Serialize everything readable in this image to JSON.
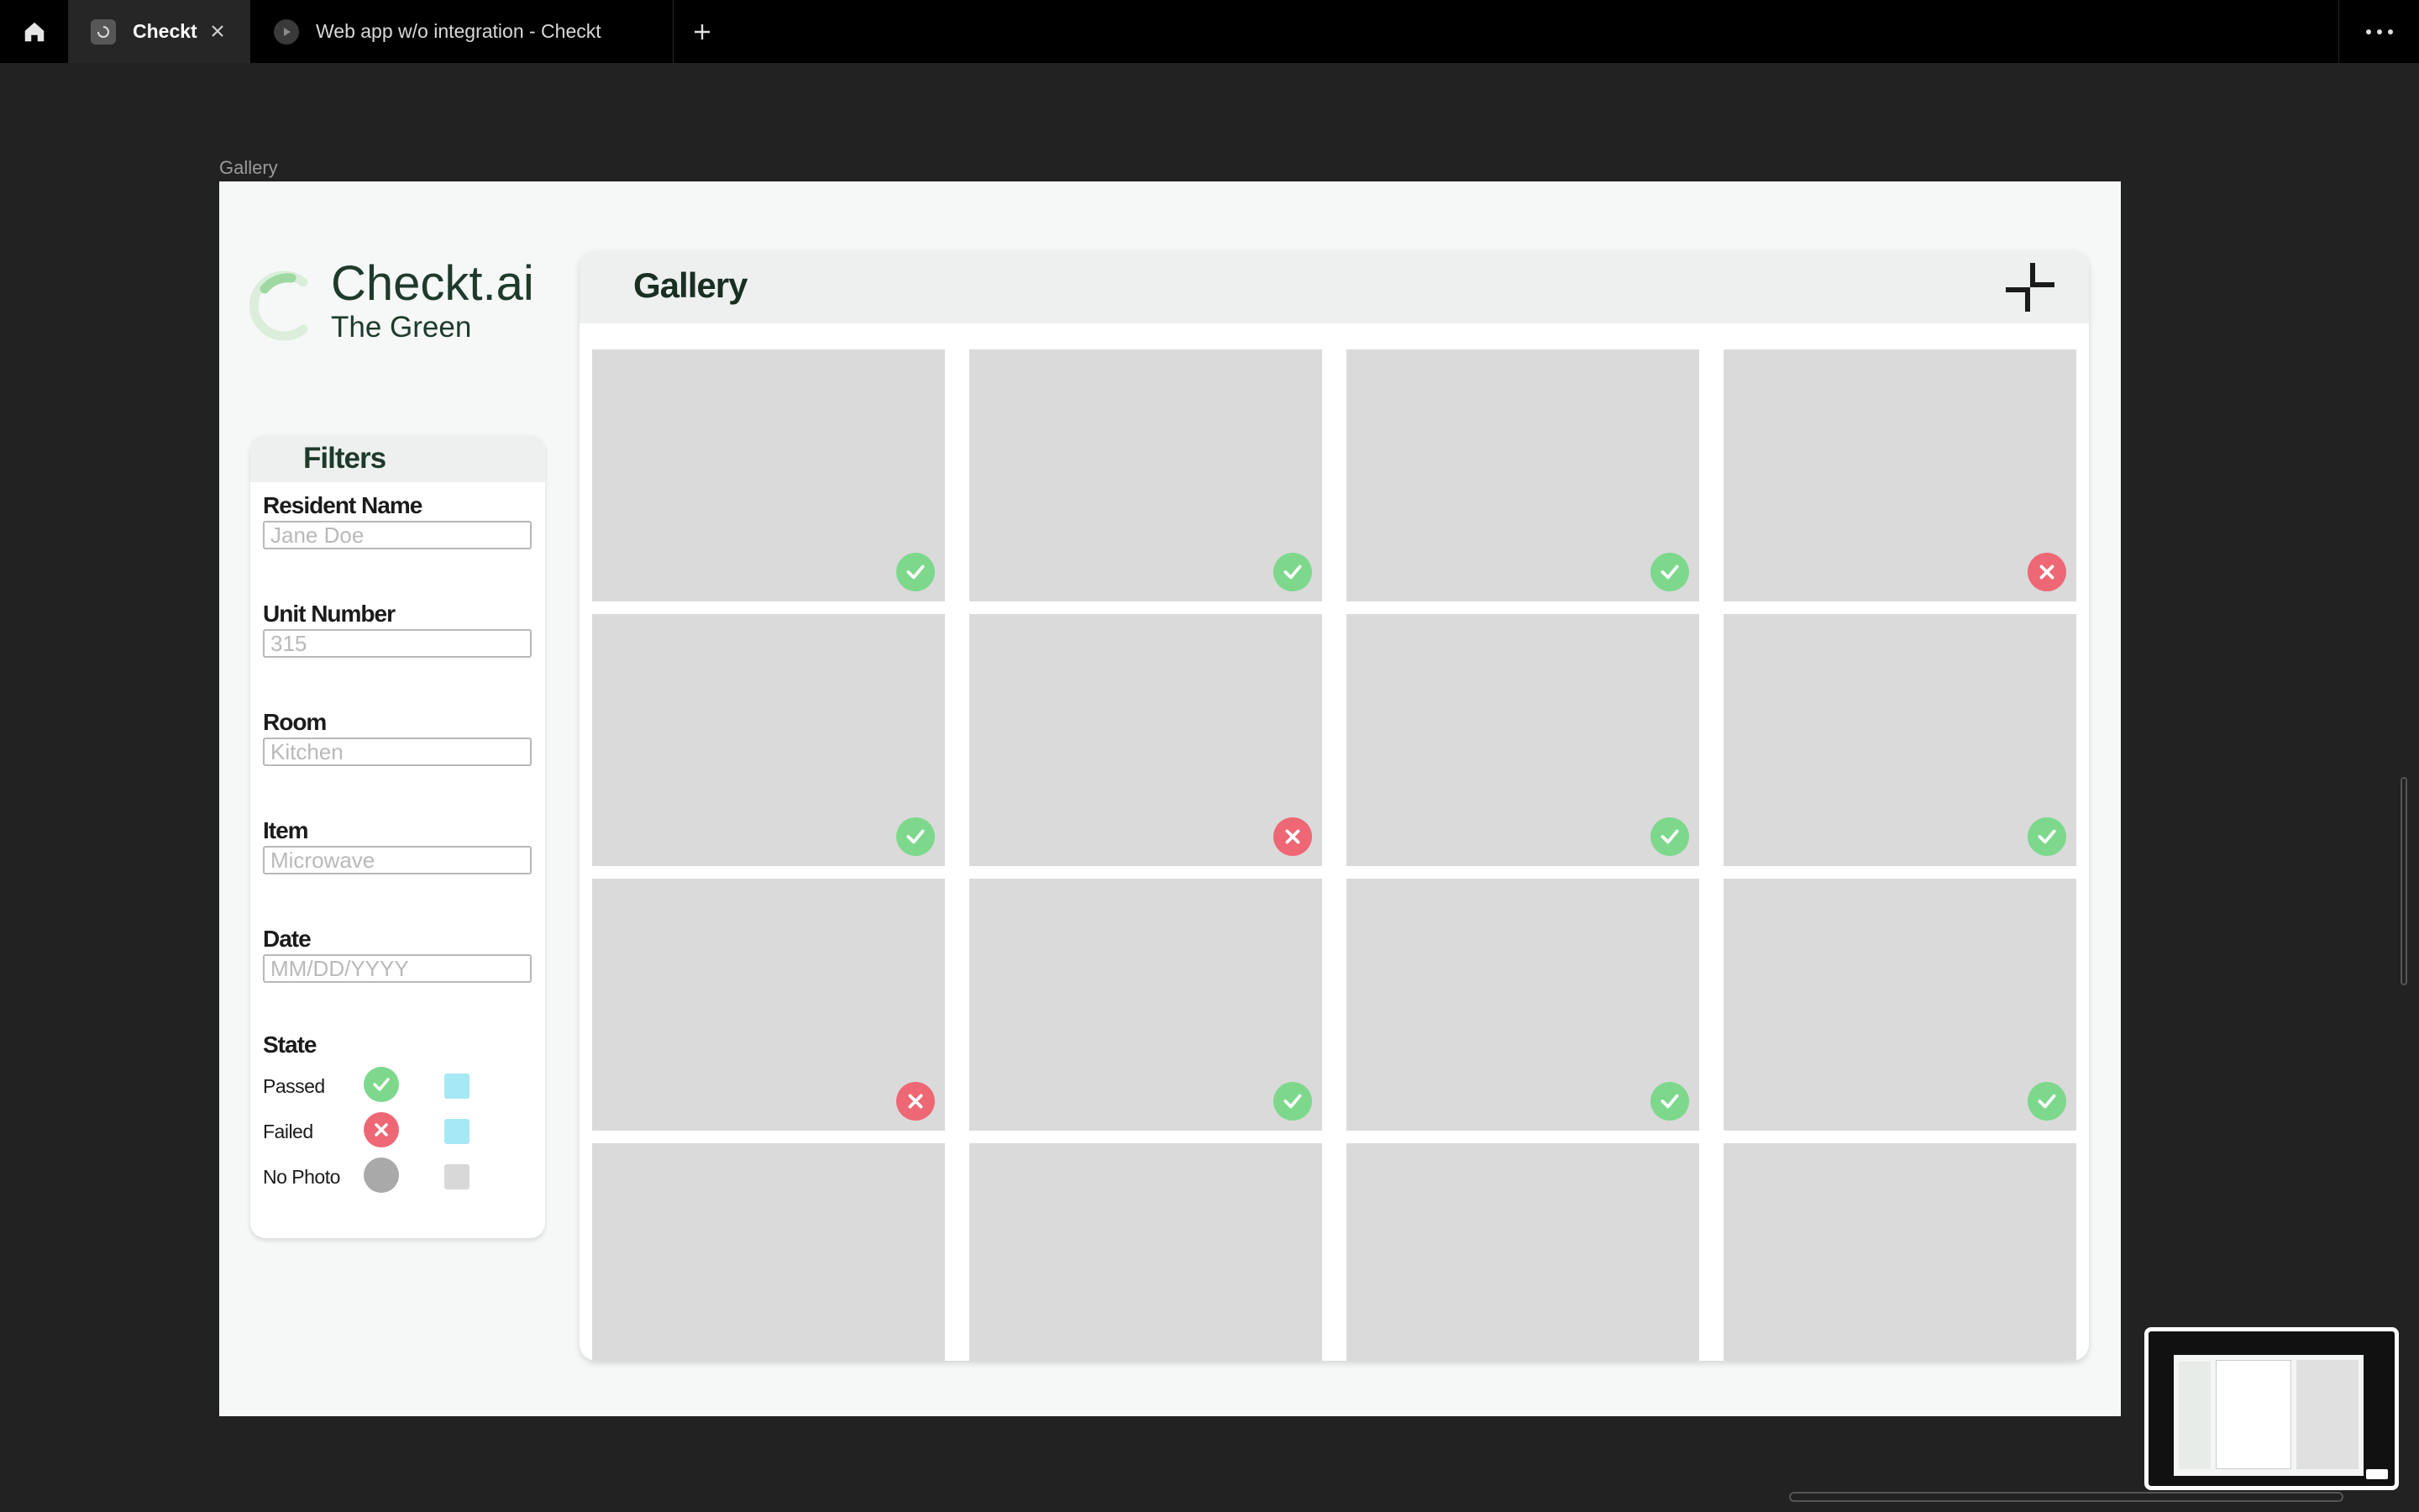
{
  "browser": {
    "tabs": [
      {
        "title": "Checkt",
        "active": true
      },
      {
        "title": "Web app w/o integration - Checkt",
        "active": false
      }
    ]
  },
  "frame": {
    "label": "Gallery"
  },
  "brand": {
    "name": "Checkt.ai",
    "subtitle": "The Green",
    "accent_color": "#d9ecd9"
  },
  "filters": {
    "title": "Filters",
    "fields": [
      {
        "label": "Resident Name",
        "placeholder": "Jane Doe"
      },
      {
        "label": "Unit Number",
        "placeholder": "315"
      },
      {
        "label": "Room",
        "placeholder": "Kitchen"
      },
      {
        "label": "Item",
        "placeholder": "Microwave"
      },
      {
        "label": "Date",
        "placeholder": "MM/DD/YYYY"
      }
    ],
    "state": {
      "title": "State",
      "options": [
        {
          "label": "Passed",
          "icon": "check-circle-icon",
          "color": "#7dd88c",
          "swatch": "#a6e8f4"
        },
        {
          "label": "Failed",
          "icon": "x-circle-icon",
          "color": "#ee6774",
          "swatch": "#a6e8f4"
        },
        {
          "label": "No Photo",
          "icon": "circle-icon",
          "color": "#a9a9a9",
          "swatch": "#d8d8d8"
        }
      ]
    }
  },
  "gallery": {
    "title": "Gallery",
    "photos": [
      {
        "status": "passed"
      },
      {
        "status": "passed"
      },
      {
        "status": "passed"
      },
      {
        "status": "failed"
      },
      {
        "status": "passed"
      },
      {
        "status": "failed"
      },
      {
        "status": "passed"
      },
      {
        "status": "passed"
      },
      {
        "status": "failed"
      },
      {
        "status": "passed"
      },
      {
        "status": "passed"
      },
      {
        "status": "passed"
      },
      {
        "status": "none"
      },
      {
        "status": "none"
      },
      {
        "status": "none"
      },
      {
        "status": "none"
      }
    ]
  },
  "colors": {
    "passed": "#7dd88c",
    "failed": "#ee6774",
    "brand_text": "#1e3a2b"
  }
}
